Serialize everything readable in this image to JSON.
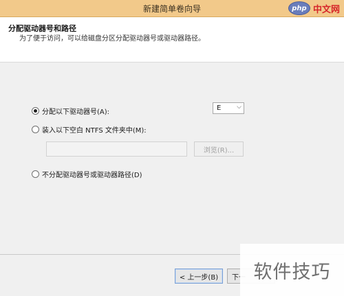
{
  "window": {
    "title": "新建简单卷向导"
  },
  "watermark": {
    "badge": "php",
    "site": "中文网",
    "bottom_text": "软件技巧"
  },
  "header": {
    "title": "分配驱动器号和路径",
    "subtitle": "为了便于访问，可以给磁盘分区分配驱动器号或驱动器路径。"
  },
  "options": {
    "assign_letter": {
      "label": "分配以下驱动器号(A):",
      "selected": true
    },
    "drive_letter_value": "E",
    "mount_folder": {
      "label": "装入以下空白 NTFS 文件夹中(M):",
      "selected": false
    },
    "path_value": "",
    "browse_label": "浏览(R)...",
    "no_assign": {
      "label": "不分配驱动器号或驱动器路径(D)",
      "selected": false
    }
  },
  "footer": {
    "back_label": "< 上一步(B)",
    "next_label": "下一"
  },
  "colors": {
    "titlebar": "#f2c98a",
    "header_bg": "#ffffff",
    "content_bg": "#f0f0f0"
  }
}
